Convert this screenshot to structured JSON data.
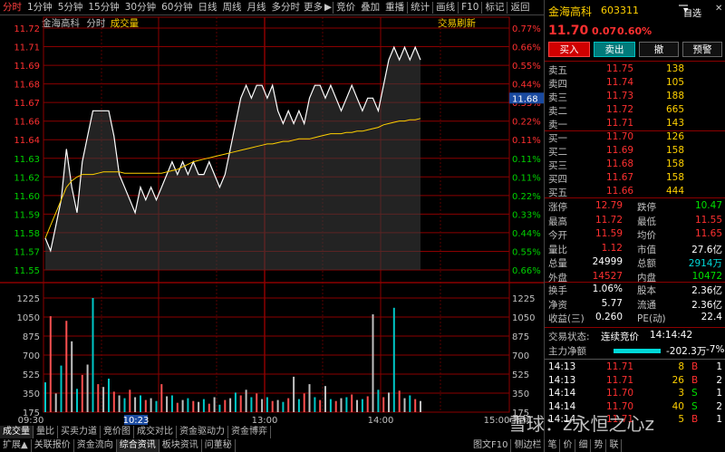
{
  "toolbar": {
    "items": [
      "分时",
      "1分钟",
      "5分钟",
      "15分钟",
      "30分钟",
      "60分钟",
      "日线",
      "周线",
      "月线",
      "多分时",
      "更多",
      "▶",
      "竞价",
      "叠加",
      "重播",
      "统计",
      "画线",
      "F10",
      "标记",
      "返回"
    ]
  },
  "chart_header": {
    "stock": "金海高科",
    "mode": "分时",
    "series": "成交量",
    "right_link": "交易刷新"
  },
  "price_axis": {
    "left": [
      "11.72",
      "11.71",
      "11.69",
      "11.68",
      "11.67",
      "11.66",
      "11.64",
      "11.63",
      "11.62",
      "11.60",
      "11.59",
      "11.58",
      "11.57",
      "11.55"
    ],
    "right": [
      "0.77%",
      "0.66%",
      "0.55%",
      "0.44%",
      "0.33%",
      "0.22%",
      "0.11%",
      "0.11%",
      "0.11%",
      "0.22%",
      "0.33%",
      "0.44%",
      "0.55%",
      "0.66%"
    ],
    "current_tag": "11.68"
  },
  "vol_axis": {
    "left": [
      "1225",
      "1050",
      "875",
      "700",
      "525",
      "350",
      "175"
    ],
    "right": [
      "1225",
      "1050",
      "875",
      "700",
      "525",
      "350",
      "175"
    ],
    "unit_label": "指标"
  },
  "time_axis": {
    "labels": [
      "09:30",
      "10:23",
      "13:00",
      "14:00",
      "15:00"
    ],
    "cursor": "10:23"
  },
  "chart_data": {
    "type": "line",
    "title": "",
    "x_range": [
      "09:30",
      "15:00"
    ],
    "ylim": [
      11.545,
      11.735
    ],
    "base": 11.63,
    "price": [
      11.57,
      11.56,
      11.58,
      11.6,
      11.64,
      11.61,
      11.59,
      11.63,
      11.65,
      11.67,
      11.67,
      11.67,
      11.67,
      11.65,
      11.62,
      11.61,
      11.6,
      11.59,
      11.61,
      11.6,
      11.61,
      11.6,
      11.61,
      11.62,
      11.63,
      11.62,
      11.63,
      11.62,
      11.63,
      11.62,
      11.62,
      11.63,
      11.62,
      11.61,
      11.62,
      11.64,
      11.66,
      11.68,
      11.69,
      11.68,
      11.69,
      11.69,
      11.68,
      11.69,
      11.67,
      11.66,
      11.67,
      11.66,
      11.67,
      11.66,
      11.68,
      11.69,
      11.69,
      11.68,
      11.69,
      11.68,
      11.67,
      11.68,
      11.69,
      11.68,
      11.67,
      11.68,
      11.68,
      11.67,
      11.69,
      11.71,
      11.72,
      11.71,
      11.72,
      11.71,
      11.72,
      11.71
    ],
    "avg": [
      11.57,
      11.58,
      11.59,
      11.6,
      11.61,
      11.615,
      11.618,
      11.62,
      11.62,
      11.62,
      11.621,
      11.622,
      11.622,
      11.622,
      11.622,
      11.621,
      11.621,
      11.621,
      11.621,
      11.621,
      11.621,
      11.621,
      11.621,
      11.622,
      11.623,
      11.624,
      11.626,
      11.628,
      11.63,
      11.631,
      11.632,
      11.633,
      11.634,
      11.635,
      11.636,
      11.637,
      11.638,
      11.639,
      11.64,
      11.641,
      11.642,
      11.643,
      11.644,
      11.644,
      11.645,
      11.646,
      11.646,
      11.647,
      11.648,
      11.648,
      11.648,
      11.649,
      11.65,
      11.651,
      11.652,
      11.652,
      11.652,
      11.653,
      11.653,
      11.654,
      11.654,
      11.655,
      11.656,
      11.657,
      11.659,
      11.66,
      11.661,
      11.662,
      11.662,
      11.663,
      11.663,
      11.664
    ],
    "volume": [
      320,
      1030,
      200,
      500,
      980,
      760,
      250,
      400,
      510,
      1225,
      300,
      270,
      360,
      220,
      180,
      150,
      240,
      160,
      180,
      130,
      150,
      120,
      300,
      170,
      180,
      100,
      130,
      150,
      120,
      110,
      140,
      90,
      160,
      80,
      130,
      150,
      210,
      180,
      240,
      160,
      200,
      140,
      160,
      120,
      130,
      110,
      150,
      380,
      140,
      200,
      300,
      160,
      130,
      280,
      140,
      120,
      150,
      160,
      190,
      130,
      140,
      170,
      1050,
      240,
      160,
      210,
      1120,
      230,
      150,
      180,
      140,
      120
    ],
    "vol_ylim": [
      0,
      1225
    ]
  },
  "quote": {
    "name": "金海高科",
    "code": "603311",
    "dropdown": "自选",
    "price": "11.70",
    "change": "0.07",
    "pct": "0.60%",
    "buy": "买入",
    "sell": "卖出",
    "cancel": "撤",
    "alert": "预警"
  },
  "asks": [
    {
      "label": "卖五",
      "price": "11.75",
      "vol": "138"
    },
    {
      "label": "卖四",
      "price": "11.74",
      "vol": "105"
    },
    {
      "label": "卖三",
      "price": "11.73",
      "vol": "188"
    },
    {
      "label": "卖二",
      "price": "11.72",
      "vol": "665"
    },
    {
      "label": "卖一",
      "price": "11.71",
      "vol": "143"
    }
  ],
  "bids": [
    {
      "label": "买一",
      "price": "11.70",
      "vol": "126"
    },
    {
      "label": "买二",
      "price": "11.69",
      "vol": "158"
    },
    {
      "label": "买三",
      "price": "11.68",
      "vol": "158"
    },
    {
      "label": "买四",
      "price": "11.67",
      "vol": "158"
    },
    {
      "label": "买五",
      "price": "11.66",
      "vol": "444"
    }
  ],
  "stats": [
    {
      "l1": "涨停",
      "v1": "12.79",
      "l2": "跌停",
      "v2": "10.47"
    },
    {
      "l1": "最高",
      "v1": "11.72",
      "l2": "最低",
      "v2": "11.55"
    },
    {
      "l1": "今开",
      "v1": "11.59",
      "l2": "均价",
      "v2": "11.65"
    },
    {
      "l1": "量比",
      "v1": "1.12",
      "l2": "市值",
      "v2": "27.6亿"
    },
    {
      "l1": "总量",
      "v1": "24999",
      "l2": "总额",
      "v2": "2914万"
    },
    {
      "l1": "外盘",
      "v1": "14527",
      "l2": "内盘",
      "v2": "10472"
    }
  ],
  "stats2": [
    {
      "l1": "换手",
      "v1": "1.06%",
      "l2": "股本",
      "v2": "2.36亿"
    },
    {
      "l1": "净资",
      "v1": "5.77",
      "l2": "流通",
      "v2": "2.36亿"
    },
    {
      "l1": "收益(三)",
      "v1": "0.260",
      "l2": "PE(动)",
      "v2": "22.4"
    }
  ],
  "status": {
    "label": "交易状态:",
    "value": "连续竞价",
    "time": "14:14:42"
  },
  "main_flow": {
    "label": "主力净额",
    "value": "-202.3万",
    "pct": "-7%"
  },
  "ticks": [
    {
      "t": "14:13",
      "p": "11.71",
      "v": "8",
      "s": "B",
      "n": "1"
    },
    {
      "t": "14:13",
      "p": "11.71",
      "v": "26",
      "s": "B",
      "n": "2"
    },
    {
      "t": "14:14",
      "p": "11.70",
      "v": "3",
      "s": "S",
      "n": "1"
    },
    {
      "t": "14:14",
      "p": "11.70",
      "v": "40",
      "s": "S",
      "n": "2"
    },
    {
      "t": "14:14",
      "p": "11.71",
      "v": "5",
      "s": "B",
      "n": "1"
    }
  ],
  "bottom_tabs": [
    "成交量",
    "量比",
    "买卖力道",
    "竞价图",
    "成交对比",
    "资金驱动力",
    "资金博弈"
  ],
  "bottom_tabs2": [
    "扩展▲",
    "关联报价",
    "资金流向",
    "综合资讯",
    "板块资讯",
    "问董秘"
  ],
  "right_bottom": {
    "tabs": [
      "图文F10",
      "侧边栏",
      "笔",
      "价",
      "细",
      "势",
      "联"
    ],
    "watermark": "雪球：z永恒之心z"
  }
}
